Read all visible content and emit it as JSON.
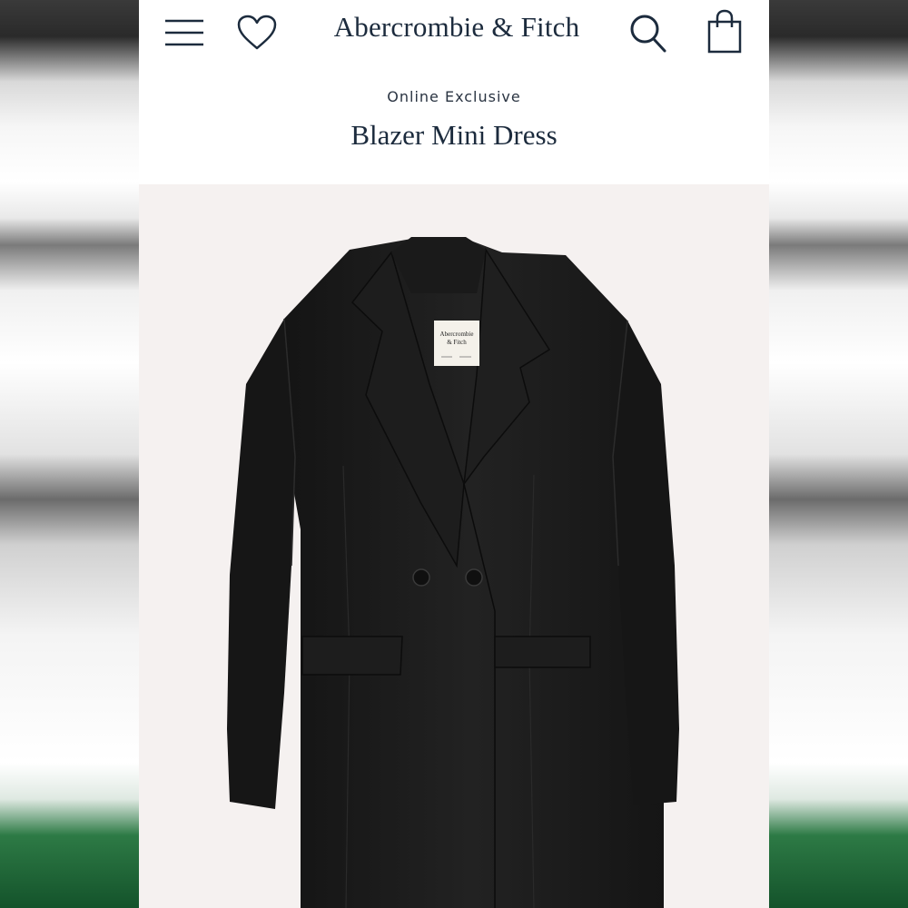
{
  "header": {
    "brand": "Abercrombie & Fitch",
    "icons": [
      "menu-icon",
      "heart-icon",
      "search-icon",
      "shopping-bag-icon"
    ]
  },
  "product": {
    "eyebrow": "Online Exclusive",
    "title": "Blazer Mini Dress",
    "label_text_line1": "Abercrombie",
    "label_text_line2": "& Fitch"
  },
  "colors": {
    "brand_navy": "#1c2b3d",
    "image_background": "#f5f1f0",
    "garment": "#1b1b1b"
  }
}
